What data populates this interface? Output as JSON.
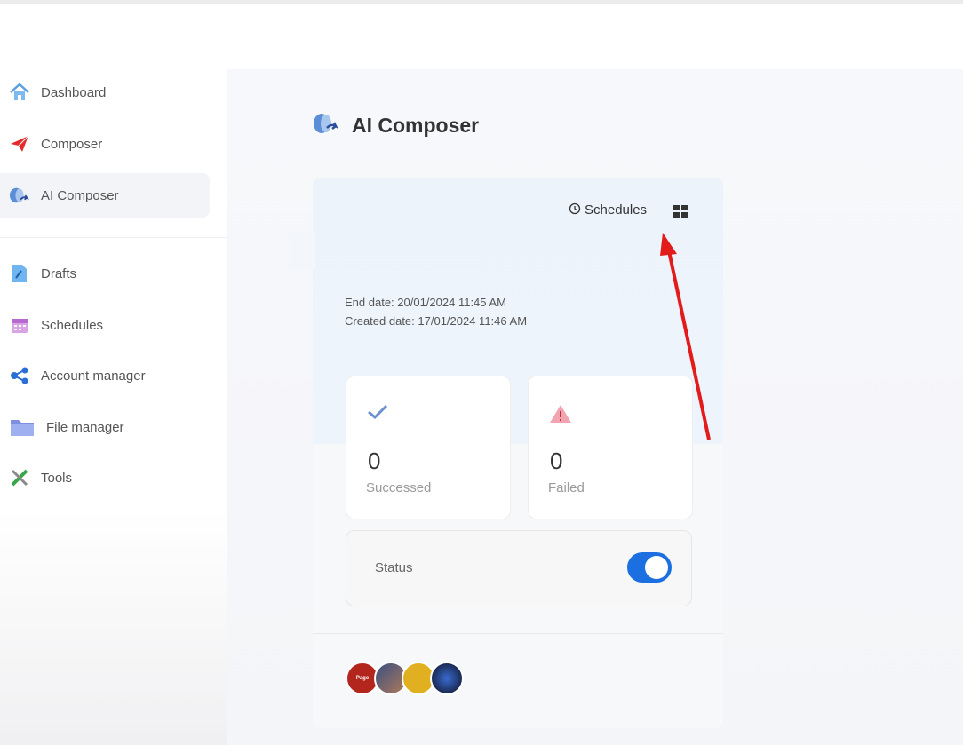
{
  "sidebar": {
    "items": [
      {
        "label": "Dashboard",
        "icon": "house-icon"
      },
      {
        "label": "Composer",
        "icon": "paper-plane-icon"
      },
      {
        "label": "AI Composer",
        "icon": "brain-icon",
        "active": true
      },
      {
        "label": "Drafts",
        "icon": "document-edit-icon"
      },
      {
        "label": "Schedules",
        "icon": "calendar-icon"
      },
      {
        "label": "Account manager",
        "icon": "share-nodes-icon"
      },
      {
        "label": "File manager",
        "icon": "folder-icon"
      },
      {
        "label": "Tools",
        "icon": "tools-icon"
      }
    ]
  },
  "page": {
    "title": "AI Composer",
    "title_icon": "brain-icon"
  },
  "card": {
    "schedules_link": "Schedules",
    "end_date": "End date: 20/01/2024 11:45 AM",
    "created_date": "Created date: 17/01/2024 11:46 AM",
    "stats": {
      "success": {
        "value": "0",
        "label": "Successed",
        "icon": "check-icon"
      },
      "failed": {
        "value": "0",
        "label": "Failed",
        "icon": "warning-icon"
      }
    },
    "status": {
      "label": "Status",
      "enabled": true
    },
    "avatars": [
      {
        "text": "Page",
        "color": "#b3261e"
      },
      {
        "text": "",
        "color": "#4a5d8a"
      },
      {
        "text": "",
        "color": "#e0b020"
      },
      {
        "text": "",
        "color": "#1a2a55"
      }
    ]
  },
  "colors": {
    "accent": "#1b6fe0",
    "annotation_arrow": "#e21b1b"
  }
}
